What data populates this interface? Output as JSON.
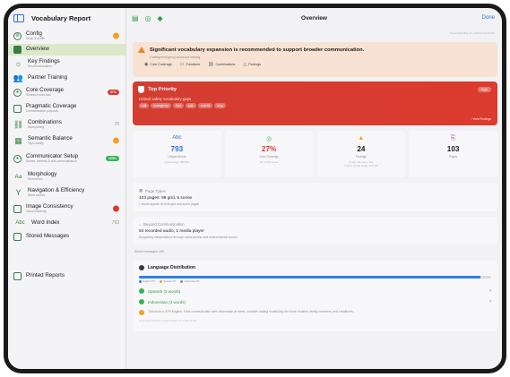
{
  "sidebar": {
    "title": "Vocabulary Report",
    "items": [
      {
        "label": "Config",
        "sub": "Setup & profile",
        "icon": "gear-icon",
        "right": "orange-dot"
      },
      {
        "label": "Overview",
        "sub": "",
        "icon": "overview-icon",
        "active": true
      },
      {
        "label": "Key Findings",
        "sub": "Recommendations",
        "icon": "lightbulb-icon"
      },
      {
        "label": "Partner Training",
        "sub": "",
        "icon": "people-icon"
      },
      {
        "label": "Core Coverage",
        "sub": "Research word lists",
        "icon": "target-icon",
        "right_badge": "37%"
      },
      {
        "label": "Pragmatic Coverage",
        "sub": "Communication purposes",
        "icon": "speech-bubble-icon"
      },
      {
        "label": "Combinations",
        "sub": "Word pairing",
        "icon": "link-icon",
        "right_num": "76"
      },
      {
        "label": "Semantic Balance",
        "sub": "Topic variety",
        "icon": "grid-icon",
        "right": "orange-dot"
      },
      {
        "label": "Communicator Setup",
        "sub": "Names, interests & auto-personalization",
        "icon": "person-icon",
        "right_badge_green": "100%"
      },
      {
        "label": "Morphology",
        "sub": "Word forms",
        "icon": "morphology-icon"
      },
      {
        "label": "Navigation & Efficiency",
        "sub": "Motor access",
        "icon": "navigation-icon"
      },
      {
        "label": "Image Consistency",
        "sub": "Visual matching",
        "icon": "image-icon",
        "right": "red-dot"
      },
      {
        "label": "Word Index",
        "sub": "",
        "icon": "abc-icon",
        "right_num": "793"
      },
      {
        "label": "Stored Messages",
        "sub": "",
        "icon": "message-icon"
      },
      {
        "label": "Printed Reports",
        "sub": "",
        "icon": "print-icon"
      }
    ]
  },
  "topbar": {
    "title": "Overview",
    "done": "Done",
    "generated": "Generated May 12, 2025 at 10:24 PM"
  },
  "banner": {
    "title": "Significant vocabulary expansion is recommended to support broader communication.",
    "sub": "6 safety/emergency words are missing",
    "tags": [
      {
        "icon": "target-icon",
        "label": "Core Coverage"
      },
      {
        "icon": "functions-icon",
        "label": "Functions"
      },
      {
        "icon": "link-icon",
        "label": "Combinations"
      },
      {
        "icon": "warning-icon",
        "label": "Findings"
      }
    ]
  },
  "priority": {
    "title": "Top Priority",
    "badge": "High",
    "subtitle": "Critical safety vocabulary gaps",
    "chips": [
      "call",
      "emergency",
      "hurt",
      "pain",
      "scared",
      "stop"
    ],
    "link": "› View Findings"
  },
  "stats": [
    {
      "icon": "Abc",
      "value": "793",
      "label": "Unique Words",
      "hint": "typical range: 300-800",
      "color": "#2f6fd6"
    },
    {
      "icon": "◎",
      "value": "27%",
      "label": "Core Coverage",
      "hint": "81 of 301 words",
      "color": "#d93a2e"
    },
    {
      "icon": "▲",
      "value": "24",
      "label": "Findings",
      "hint": "6 high, 16 med, 2 low",
      "hint2": "Typical: typical range: 100-400",
      "color": "#1c1c1e"
    },
    {
      "icon": "⎘",
      "value": "103",
      "label": "Pages",
      "hint": "",
      "color": "#1c1c1e"
    }
  ],
  "page_types": {
    "head": "Page Types",
    "line": "103 pages: 98 grid, 5 scene",
    "sub": "7 words appear on both grid and scene pages"
  },
  "beyond": {
    "head": "Beyond Communication",
    "line": "64 recorded audio, 1 media player",
    "sub": "Supporting independence through media access and environmental control"
  },
  "stored_messages": "Stored messages: 229",
  "language": {
    "title": "Language Distribution",
    "english_pct": 97,
    "legend": [
      {
        "label": "English 97%",
        "color": "#2f7fe4"
      },
      {
        "label": "Spanish 0%",
        "color": "#f0a028"
      },
      {
        "label": "Indonesian 0%",
        "color": "#8e8e93"
      }
    ],
    "rows": [
      "Spanish (3 words)",
      "Indonesian (3 words)"
    ],
    "note": "This book is 97% English. If the communicator uses Indonesian at home, consider adding vocabulary for home routines, family members, and mealtimes.",
    "hint": "Language detection is approximate for single words"
  }
}
